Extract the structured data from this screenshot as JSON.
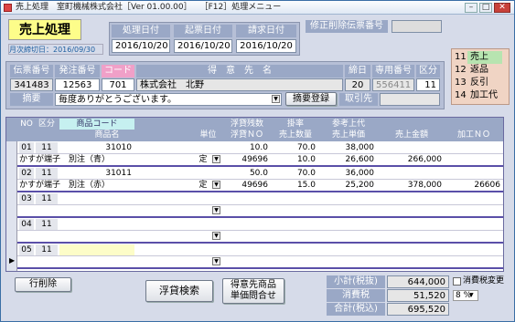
{
  "window": {
    "title": "売上処理　室町機械株式会社［Ver 01.00.00］　　［F12］処理メニュー",
    "min": "–",
    "max": "□",
    "close": "✕"
  },
  "header": {
    "screen_title": "売上処理",
    "month_end": "月次締切日：2016/09/30",
    "dates": [
      {
        "label": "処理日付",
        "value": "2016/10/20"
      },
      {
        "label": "起票日付",
        "value": "2016/10/20"
      },
      {
        "label": "請求日付",
        "value": "2016/10/20"
      }
    ],
    "edit_slip_label": "修正削除伝票番号",
    "edit_slip_value": ""
  },
  "menu": {
    "items": [
      {
        "num": "11",
        "label": "売上"
      },
      {
        "num": "12",
        "label": "返品"
      },
      {
        "num": "13",
        "label": "反引"
      },
      {
        "num": "14",
        "label": "加工代"
      }
    ]
  },
  "slip": {
    "headers": [
      "伝票番号",
      "発注番号",
      "コード",
      "得　意　先　名",
      "締日",
      "専用番号",
      "区分"
    ],
    "values": [
      "341483",
      "12563",
      "701",
      "株式会社　北野",
      "20",
      "556411",
      "11"
    ],
    "summary_label": "摘要",
    "summary_value": "毎度ありがとうございます。",
    "summary_button": "摘要登録",
    "supplier_label": "取引先"
  },
  "grid": {
    "header_row1": [
      "NO",
      "区分",
      "商品コード",
      "",
      "",
      "浮貸残数",
      "掛率",
      "参考上代",
      "",
      ""
    ],
    "header_row2": [
      "商品名",
      "単位",
      "浮貸ＮＯ",
      "売上数量",
      "売上単価",
      "売上金額",
      "加工ＮＯ"
    ],
    "rows": [
      {
        "no": "01",
        "kubun": "11",
        "code": "31010",
        "zan": "10.0",
        "rate": "70.0",
        "jodai": "38,000",
        "name": "かすが端子　別注（青）",
        "unit": "定",
        "fno": "49696",
        "qty": "10.0",
        "price": "26,600",
        "amount": "266,000",
        "kakou": ""
      },
      {
        "no": "02",
        "kubun": "11",
        "code": "31011",
        "zan": "50.0",
        "rate": "70.0",
        "jodai": "36,000",
        "name": "かすが端子　別注（赤）",
        "unit": "定",
        "fno": "49696",
        "qty": "15.0",
        "price": "25,200",
        "amount": "378,000",
        "kakou": "26606"
      },
      {
        "no": "03",
        "kubun": "11",
        "code": "",
        "zan": "",
        "rate": "",
        "jodai": "",
        "name": "",
        "unit": "",
        "fno": "",
        "qty": "",
        "price": "",
        "amount": "",
        "kakou": ""
      },
      {
        "no": "04",
        "kubun": "11",
        "code": "",
        "zan": "",
        "rate": "",
        "jodai": "",
        "name": "",
        "unit": "",
        "fno": "",
        "qty": "",
        "price": "",
        "amount": "",
        "kakou": ""
      },
      {
        "no": "05",
        "kubun": "11",
        "code": "",
        "zan": "",
        "rate": "",
        "jodai": "",
        "name": "",
        "unit": "",
        "fno": "",
        "qty": "",
        "price": "",
        "amount": "",
        "kakou": ""
      }
    ]
  },
  "footer": {
    "delete_row": "行削除",
    "float_search": "浮貸検索",
    "customer_price_line1": "得意先商品",
    "customer_price_line2": "単価問合せ",
    "subtotal_label": "小計(税抜)",
    "subtotal_value": "644,000",
    "tax_label": "消費税",
    "tax_value": "51,520",
    "total_label": "合計(税込)",
    "total_value": "695,520",
    "tax_change_label": "消費税変更",
    "tax_rate": "8 %"
  }
}
